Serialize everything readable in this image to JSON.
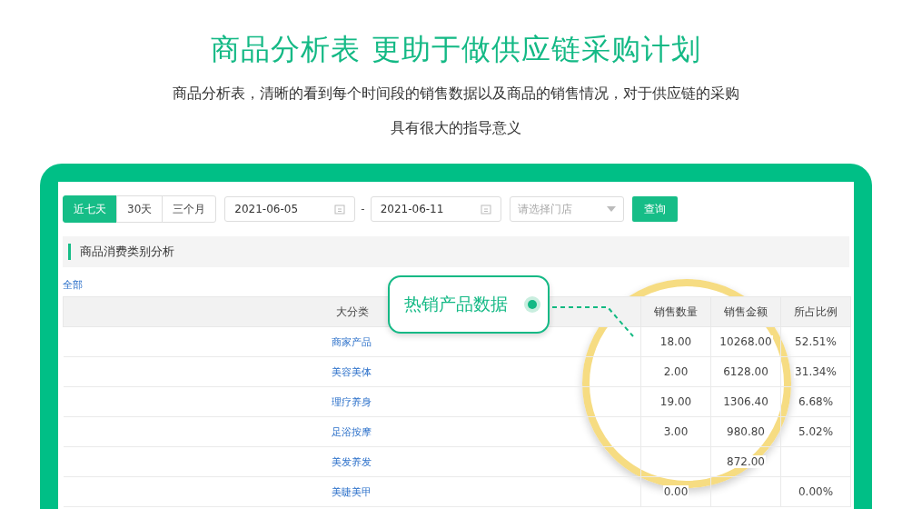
{
  "headline": "商品分析表 更助于做供应链采购计划",
  "intro": [
    "商品分析表，清晰的看到每个时间段的销售数据以及商品的销售情况，对于供应链的采购",
    "具有很大的指导意义"
  ],
  "range_tabs": [
    {
      "label": "近七天",
      "selected": true
    },
    {
      "label": "30天",
      "selected": false
    },
    {
      "label": "三个月",
      "selected": false
    }
  ],
  "start_date": "2021-06-05",
  "separator": "-",
  "end_date": "2021-06-11",
  "store_select": {
    "placeholder": "请选择门店"
  },
  "query_button": "查询",
  "section_title": "商品消费类别分析",
  "all_link": "全部",
  "table": {
    "columns": [
      "大分类",
      "销售数量",
      "销售金额",
      "所占比例"
    ],
    "rows": [
      {
        "cells": [
          "商家产品",
          "18.00",
          "10268.00",
          "52.51%"
        ]
      },
      {
        "cells": [
          "美容美体",
          "2.00",
          "6128.00",
          "31.34%"
        ]
      },
      {
        "cells": [
          "理疗养身",
          "19.00",
          "1306.40",
          "6.68%"
        ]
      },
      {
        "cells": [
          "足浴按摩",
          "3.00",
          "980.80",
          "5.02%"
        ]
      },
      {
        "cells": [
          "美发养发",
          null,
          "872.00",
          null
        ]
      },
      {
        "cells": [
          "美睫美甲",
          "0.00",
          null,
          "0.00%"
        ]
      }
    ]
  },
  "callout": "热销产品数据"
}
